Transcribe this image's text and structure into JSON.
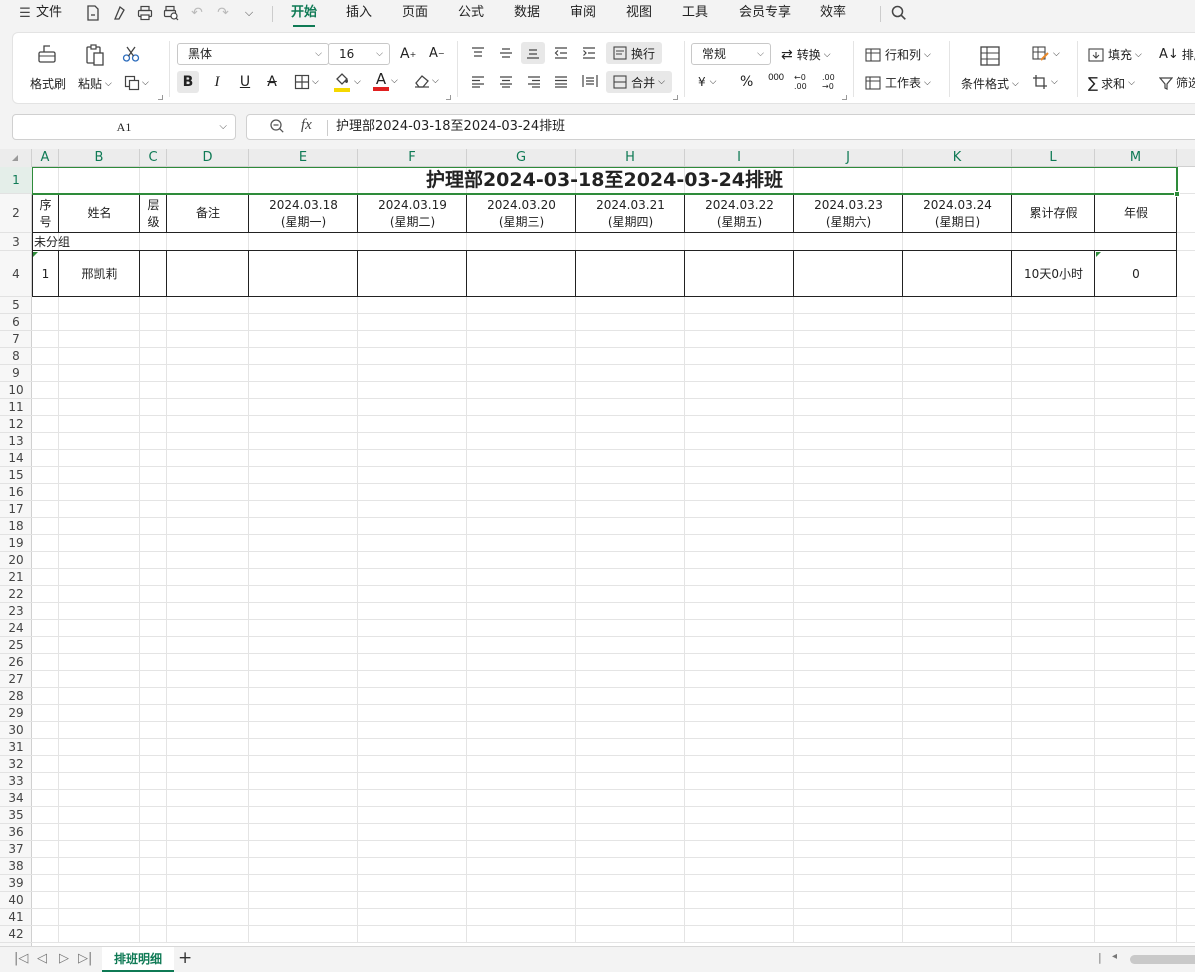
{
  "menu": {
    "file_label": "文件",
    "tabs": [
      "开始",
      "插入",
      "页面",
      "公式",
      "数据",
      "审阅",
      "视图",
      "工具",
      "会员专享",
      "效率"
    ],
    "active_tab": "开始"
  },
  "ribbon": {
    "format_painter": "格式刷",
    "paste": "粘贴",
    "font_name": "黑体",
    "font_size": "16",
    "wrap": "换行",
    "merge": "合并",
    "number_format": "常规",
    "convert": "转换",
    "row_col": "行和列",
    "worksheet": "工作表",
    "cond_format": "条件格式",
    "fill": "填充",
    "sum": "求和",
    "sort": "排序",
    "filter": "筛选",
    "bold": "B",
    "italic": "I",
    "underline": "U",
    "strike": "A",
    "font_color_glyph": "A",
    "font_color": "#e02020",
    "fill_color": "#f5d800",
    "currency": "¥",
    "percent": "%",
    "thousands": "000",
    "dec_inc": "←0 .00",
    "dec_dec": ".00 →0"
  },
  "formula_bar": {
    "cell_ref": "A1",
    "fx": "fx",
    "content": "护理部2024-03-18至2024-03-24排班"
  },
  "columns": [
    "A",
    "B",
    "C",
    "D",
    "E",
    "F",
    "G",
    "H",
    "I",
    "J",
    "K",
    "L",
    "M"
  ],
  "rows": [
    "1",
    "2",
    "3",
    "4",
    "5",
    "6",
    "7",
    "8",
    "9",
    "10",
    "11",
    "12",
    "13",
    "14",
    "15",
    "16",
    "17",
    "18",
    "19",
    "20",
    "21",
    "22",
    "23",
    "24",
    "25",
    "26",
    "27",
    "28",
    "29",
    "30",
    "31",
    "32",
    "33",
    "34",
    "35",
    "36",
    "37",
    "38",
    "39",
    "40",
    "41",
    "42"
  ],
  "sheet": {
    "title": "护理部2024-03-18至2024-03-24排班",
    "headers": {
      "seq": "序\n号",
      "name": "姓名",
      "level": "层\n级",
      "note": "备注",
      "days": [
        "2024.03.18\n(星期一)",
        "2024.03.19\n(星期二)",
        "2024.03.20\n(星期三)",
        "2024.03.21\n(星期四)",
        "2024.03.22\n(星期五)",
        "2024.03.23\n(星期六)",
        "2024.03.24\n(星期日)"
      ],
      "leave": "累计存假",
      "annual": "年假"
    },
    "group": "未分组",
    "record": {
      "seq": "1",
      "name": "邢凯莉",
      "leave": "10天0小时",
      "annual": "0"
    }
  },
  "sheet_tabs": [
    "排班明细"
  ],
  "colors": {
    "accent": "#0f7a55",
    "selection": "#2e8b3a"
  }
}
